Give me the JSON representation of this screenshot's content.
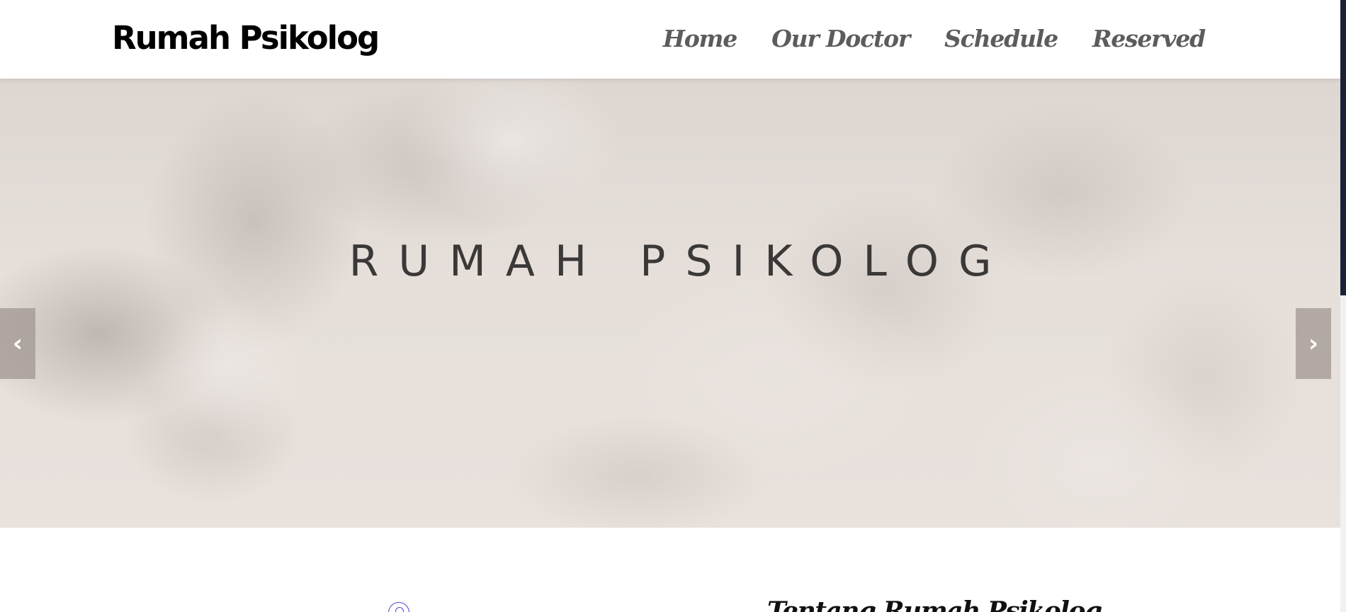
{
  "brand": {
    "name": "Rumah Psikolog"
  },
  "nav": {
    "items": [
      {
        "label": "Home"
      },
      {
        "label": "Our Doctor"
      },
      {
        "label": "Schedule"
      },
      {
        "label": "Reserved"
      }
    ]
  },
  "hero": {
    "title": "RUMAH PSIKOLOG",
    "prev_icon": "‹",
    "next_icon": "›"
  },
  "about": {
    "title": "Tentang Rumah Psikolog",
    "icon": "circle-icon"
  },
  "colors": {
    "brand_text": "#000000",
    "nav_text": "#5c5c5c",
    "hero_bg": "#e6dfda",
    "hero_text": "#3b3838",
    "scroll_thumb": "#1a2238"
  }
}
